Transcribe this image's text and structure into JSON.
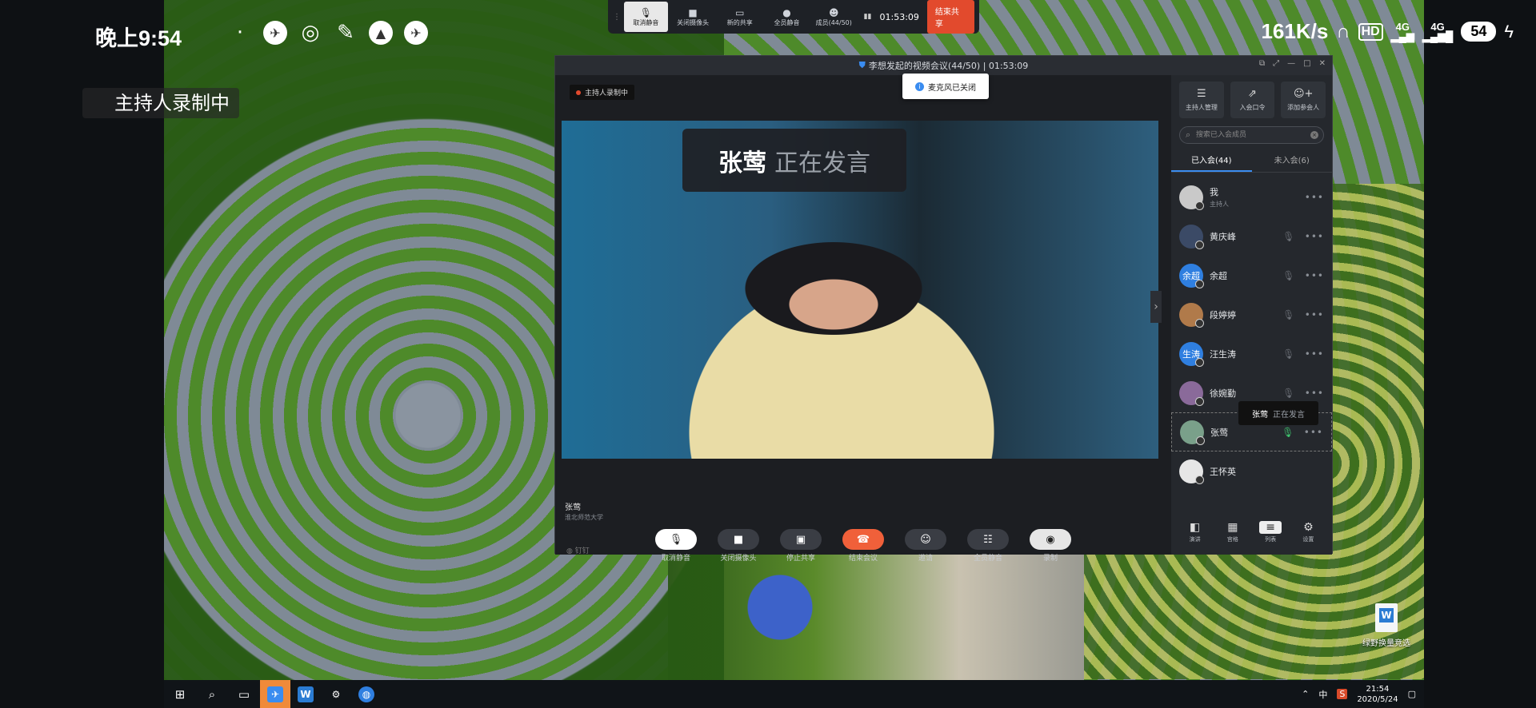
{
  "status_bar": {
    "time": "晚上9:54",
    "net_speed": "161K/s",
    "hd": "HD",
    "sig1": "4G",
    "sig2": "4G",
    "battery": "54"
  },
  "recording_badge": "主持人录制中",
  "share_bar": {
    "items": [
      "取消静音",
      "关闭摄像头",
      "新的共享",
      "全员静音",
      "成员(44/50)"
    ],
    "timer": "01:53:09",
    "end_share": "结束共享"
  },
  "meeting": {
    "title": "李想发起的视频会议(44/50)  |  01:53:09",
    "toast": "麦克风已关闭",
    "host_rec_tag": "主持人录制中",
    "speaker_popup": {
      "name": "张莺",
      "state": "正在发言"
    },
    "speaker_name": "张莺",
    "speaker_org": "淮北师范大学",
    "dingding": "钉钉",
    "controls": [
      "取消静音",
      "关闭摄像头",
      "停止共享",
      "结束会议",
      "邀请",
      "全员静音",
      "录制"
    ],
    "side_top": [
      "主持人管理",
      "入会口令",
      "添加参会人"
    ],
    "search_placeholder": "搜索已入会成员",
    "tabs": [
      "已入会(44)",
      "未入会(6)"
    ],
    "members": [
      {
        "name": "我",
        "role": "主持人",
        "avatar": "",
        "color": "#c9c9c9"
      },
      {
        "name": "黄庆峰",
        "role": "",
        "avatar": "",
        "color": "#3b4a66"
      },
      {
        "name": "余超",
        "role": "",
        "avatar": "余超",
        "color": "#2f7fe0"
      },
      {
        "name": "段婷婷",
        "role": "",
        "avatar": "",
        "color": "#b07a4a"
      },
      {
        "name": "汪生涛",
        "role": "",
        "avatar": "生涛",
        "color": "#2f7fe0"
      },
      {
        "name": "徐婉勤",
        "role": "",
        "avatar": "",
        "color": "#8a6a9a"
      },
      {
        "name": "张莺",
        "role": "",
        "avatar": "",
        "color": "#7aa08a"
      },
      {
        "name": "王怀英",
        "role": "",
        "avatar": "",
        "color": "#e6e6e6"
      }
    ],
    "member_tip": {
      "name": "张莺",
      "state": "正在发言"
    },
    "side_bottom": [
      "演讲",
      "宫格",
      "列表",
      "设置"
    ]
  },
  "desktop_icon": "绿野换量竞选",
  "taskbar": {
    "tray_ime": "中",
    "clock_time": "21:54",
    "clock_date": "2020/5/24"
  }
}
